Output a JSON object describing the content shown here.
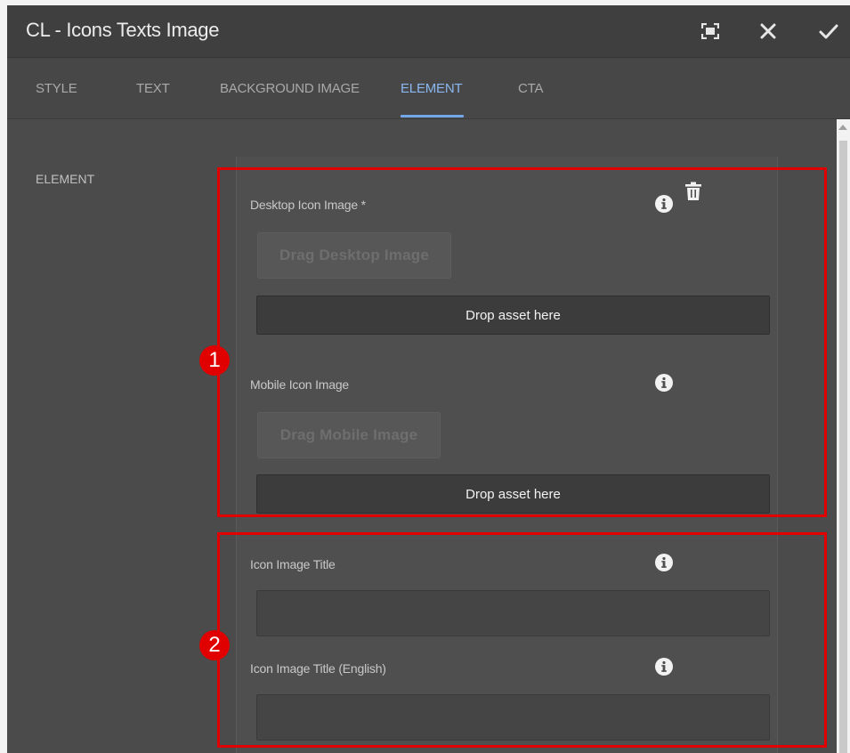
{
  "dialog": {
    "title": "CL - Icons Texts Image",
    "actions": [
      "fullscreen-icon",
      "close-icon",
      "done-icon"
    ]
  },
  "tabs": [
    {
      "label": "STYLE",
      "active": false
    },
    {
      "label": "TEXT",
      "active": false
    },
    {
      "label": "BACKGROUND IMAGE",
      "active": false
    },
    {
      "label": "ELEMENT",
      "active": true
    },
    {
      "label": "CTA",
      "active": false
    }
  ],
  "section": {
    "label": "ELEMENT"
  },
  "fields": {
    "desktop_icon": {
      "label": "Desktop Icon Image *",
      "drag_label": "Drag Desktop Image",
      "drop_label": "Drop asset here"
    },
    "mobile_icon": {
      "label": "Mobile Icon Image",
      "drag_label": "Drag Mobile Image",
      "drop_label": "Drop asset here"
    },
    "icon_title": {
      "label": "Icon Image Title",
      "value": ""
    },
    "icon_title_english": {
      "label": "Icon Image Title (English)",
      "value": ""
    }
  },
  "annotations": [
    {
      "number": "1"
    },
    {
      "number": "2"
    }
  ],
  "colors": {
    "dialog_bg": "#4b4b4b",
    "accent": "#72a7ea",
    "annotation": "#e00000"
  }
}
